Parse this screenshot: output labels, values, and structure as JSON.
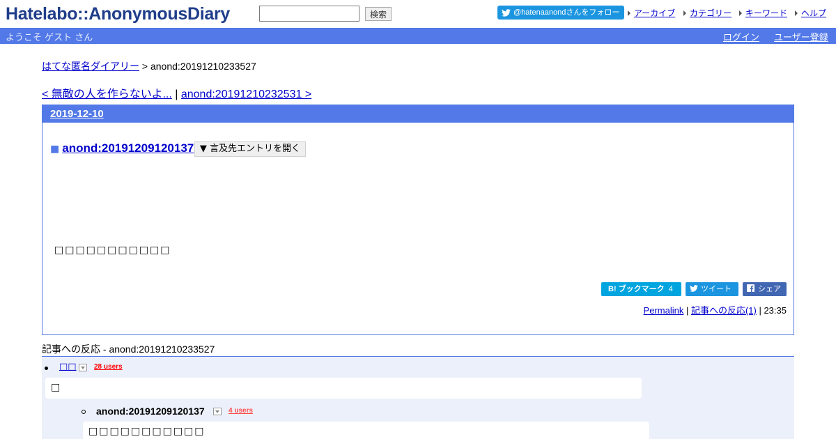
{
  "header": {
    "logo": "Hatelabo::AnonymousDiary",
    "search_button": "検索",
    "follow_button": "@hatenaanondさんをフォロー",
    "nav": [
      "アーカイブ",
      "カテゴリー",
      "キーワード",
      "ヘルプ"
    ]
  },
  "bluebar": {
    "welcome": "ようこそ ゲスト さん",
    "login": "ログイン",
    "register": "ユーザー登録"
  },
  "breadcrumb": {
    "home": "はてな匿名ダイアリー",
    "separator": " > ",
    "current": "anond:20191210233527"
  },
  "pager": {
    "prev": "< 無敵の人を作らないよ...",
    "separator": " | ",
    "next": "anond:20191210232531 >"
  },
  "day": {
    "date": "2019-12-10",
    "section_bullet": "■",
    "section_title": "anond:20191209120137",
    "refer_button": "▼ 言及先エントリを開く",
    "body": "□□□□□□□□□□□",
    "share": {
      "hatena_label": "B! ブックマーク",
      "hatena_count": "4",
      "tweet": "ツイート",
      "share": "シェア"
    },
    "footer": {
      "permalink": "Permalink",
      "sep1": " | ",
      "reactions": "記事への反応(1)",
      "sep2": " | ",
      "time": "23:35"
    }
  },
  "refs": {
    "title": "記事への反応 - anond:20191210233527",
    "items": [
      {
        "link": "□□",
        "users": "28 users",
        "text": "□",
        "color": "#ff0000"
      },
      {
        "title": "anond:20191209120137",
        "users": "4 users",
        "text": "□□□□□□□□□□□",
        "color": "#ff4c4c"
      }
    ]
  },
  "colors": {
    "accent": "#5279e7",
    "link": "#0000cc",
    "twitter": "#1b95e0",
    "hatena": "#00a4de",
    "facebook": "#4267b2"
  }
}
